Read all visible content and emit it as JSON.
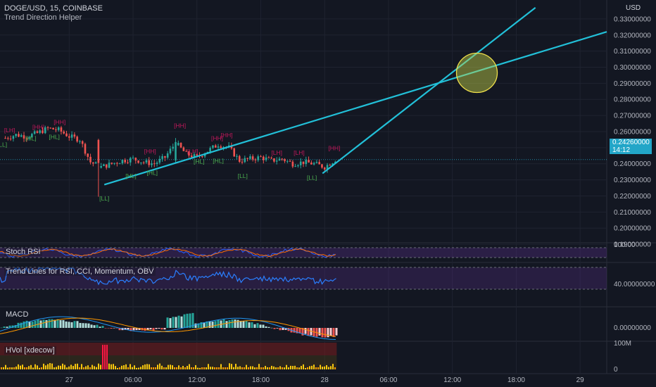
{
  "header": {
    "symbol_line": "DOGE/USD, 15, COINBASE",
    "indicator": "Trend Direction Helper"
  },
  "price_axis": {
    "currency": "USD",
    "labels": [
      "0.33000000",
      "0.32000000",
      "0.31000000",
      "0.30000000",
      "0.29000000",
      "0.28000000",
      "0.27000000",
      "0.26000000",
      "0.25000000",
      "0.24000000",
      "0.23000000",
      "0.22000000",
      "0.21000000",
      "0.20000000",
      "0.19000000"
    ],
    "values": [
      0.33,
      0.32,
      0.31,
      0.3,
      0.29,
      0.28,
      0.27,
      0.26,
      0.25,
      0.24,
      0.23,
      0.22,
      0.21,
      0.2,
      0.19
    ],
    "current_price": "0.24260000",
    "countdown": "14:12",
    "current_value": 0.2426
  },
  "time_axis": {
    "labels": [
      "27",
      "06:00",
      "12:00",
      "18:00",
      "28",
      "06:00",
      "12:00",
      "18:00",
      "29"
    ],
    "hours": [
      0,
      6,
      12,
      18,
      24,
      30,
      36,
      42,
      48
    ]
  },
  "colors": {
    "background": "#131722",
    "trendline": "#22c0d8",
    "bull": "#26a69a",
    "bear": "#ef5350",
    "pivot_high": "#c2185b",
    "pivot_low": "#4caf50",
    "ellipse_fill": "#c8d84a",
    "ellipse_stroke": "#f0e04a",
    "stoch_band": "#5a2e8a",
    "rsi_line": "#2a7fff",
    "macd_line": "#2196f3",
    "signal_line": "#ff9800",
    "hvol_bg": "#7a1e1e"
  },
  "chart_data": [
    {
      "type": "candlestick",
      "title": "DOGE/USD, 15, COINBASE",
      "x_unit": "hours since 27 00:00",
      "ylim": [
        0.185,
        0.335
      ],
      "xlim": [
        -6.5,
        50.5
      ],
      "close_series": {
        "x": [
          -6,
          -5,
          -4,
          -3,
          -2,
          -1,
          0,
          1,
          2,
          3,
          4,
          5,
          6,
          7,
          8,
          9,
          10,
          11,
          12,
          13,
          14,
          15,
          16,
          17,
          18,
          19,
          20,
          21,
          22,
          23,
          24,
          25
        ],
        "y": [
          0.256,
          0.258,
          0.257,
          0.259,
          0.262,
          0.261,
          0.257,
          0.255,
          0.241,
          0.238,
          0.24,
          0.242,
          0.243,
          0.241,
          0.24,
          0.244,
          0.253,
          0.246,
          0.244,
          0.248,
          0.252,
          0.25,
          0.242,
          0.243,
          0.244,
          0.242,
          0.243,
          0.24,
          0.241,
          0.24,
          0.238,
          0.2426
        ]
      },
      "pivots": [
        {
          "label": "[LH]",
          "x": -5.6,
          "y": 0.2595,
          "kind": "high"
        },
        {
          "label": "[HH]",
          "x": -2.9,
          "y": 0.2615,
          "kind": "high"
        },
        {
          "label": "[HH]",
          "x": -0.9,
          "y": 0.2645,
          "kind": "high"
        },
        {
          "label": "[LL]",
          "x": -6.3,
          "y": 0.2505,
          "kind": "low"
        },
        {
          "label": "[HL]",
          "x": -3.6,
          "y": 0.2545,
          "kind": "low"
        },
        {
          "label": "[HL]",
          "x": -1.4,
          "y": 0.2555,
          "kind": "low"
        },
        {
          "label": "[LL]",
          "x": 3.3,
          "y": 0.2172,
          "kind": "low"
        },
        {
          "label": "[HL]",
          "x": 5.8,
          "y": 0.2312,
          "kind": "low"
        },
        {
          "label": "[HL]",
          "x": 7.8,
          "y": 0.2332,
          "kind": "low"
        },
        {
          "label": "[HH]",
          "x": 7.6,
          "y": 0.2465,
          "kind": "high"
        },
        {
          "label": "[HH]",
          "x": 10.4,
          "y": 0.2625,
          "kind": "high"
        },
        {
          "label": "[HL]",
          "x": 12.2,
          "y": 0.2402,
          "kind": "low"
        },
        {
          "label": "[LH]",
          "x": 11.6,
          "y": 0.2465,
          "kind": "high"
        },
        {
          "label": "[HH]",
          "x": 13.9,
          "y": 0.2545,
          "kind": "high"
        },
        {
          "label": "[HH]",
          "x": 14.8,
          "y": 0.2565,
          "kind": "high"
        },
        {
          "label": "[HL]",
          "x": 14.0,
          "y": 0.2405,
          "kind": "low"
        },
        {
          "label": "[LL]",
          "x": 16.3,
          "y": 0.2312,
          "kind": "low"
        },
        {
          "label": "[LH]",
          "x": 19.5,
          "y": 0.2455,
          "kind": "high"
        },
        {
          "label": "[LH]",
          "x": 21.6,
          "y": 0.2455,
          "kind": "high"
        },
        {
          "label": "[LL]",
          "x": 22.8,
          "y": 0.23,
          "kind": "low"
        },
        {
          "label": "[HH]",
          "x": 24.9,
          "y": 0.2485,
          "kind": "high"
        }
      ],
      "trendlines": [
        {
          "x1": 3.3,
          "y1": 0.227,
          "x2": 50.5,
          "y2": 0.322
        },
        {
          "x1": 23.8,
          "y1": 0.234,
          "x2": 43.8,
          "y2": 0.337
        }
      ],
      "ellipse": {
        "x": 38.3,
        "y": 0.2965
      }
    },
    {
      "type": "line",
      "title": "Stoch RSI",
      "axis_label": "100.00",
      "ylim": [
        0,
        100
      ]
    },
    {
      "type": "line",
      "title": "Trend Lines for RSI, CCI, Momentum, OBV",
      "axis_label": "40.00000000"
    },
    {
      "type": "bar",
      "title": "MACD",
      "axis_label": "0.00000000"
    },
    {
      "type": "bar",
      "title": "HVol [xdecow]",
      "axis_labels": [
        "100M",
        "0"
      ]
    }
  ]
}
